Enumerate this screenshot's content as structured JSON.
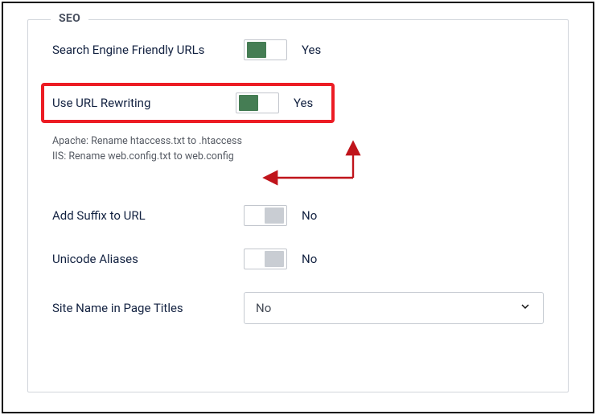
{
  "legend": "SEO",
  "rows": {
    "sef": {
      "label": "Search Engine Friendly URLs",
      "state": "Yes"
    },
    "rewrite": {
      "label": "Use URL Rewriting",
      "state": "Yes"
    },
    "suffix": {
      "label": "Add Suffix to URL",
      "state": "No"
    },
    "unicode": {
      "label": "Unicode Aliases",
      "state": "No"
    },
    "sitename": {
      "label": "Site Name in Page Titles",
      "value": "No"
    }
  },
  "note": {
    "line1": "Apache: Rename htaccess.txt to .htaccess",
    "line2": "IIS: Rename web.config.txt to web.config"
  }
}
